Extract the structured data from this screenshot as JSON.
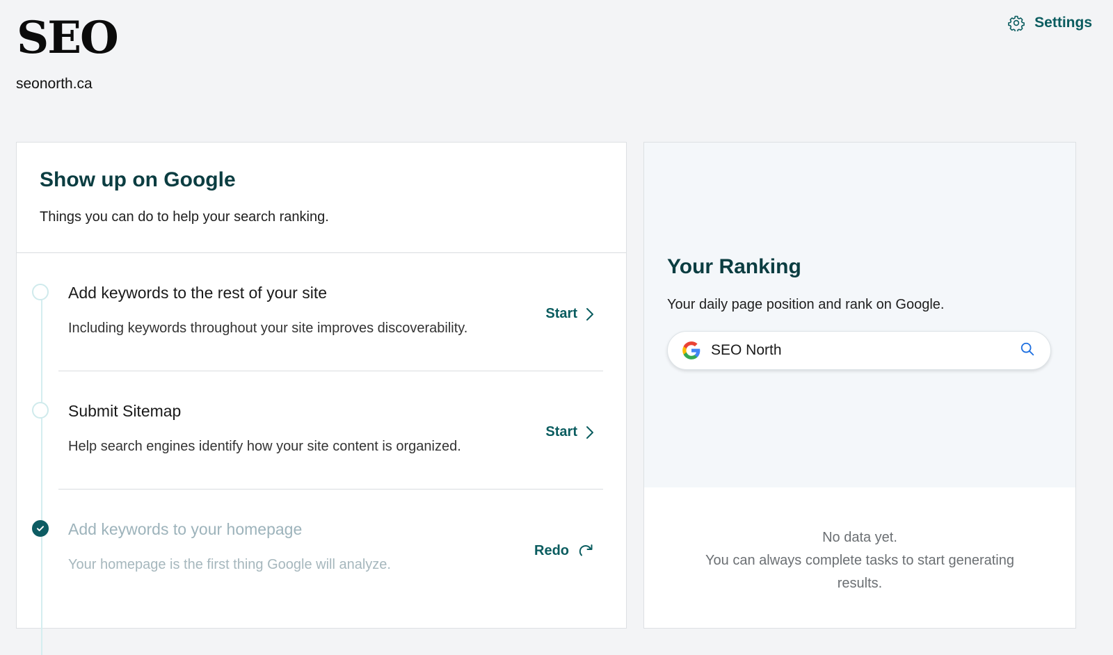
{
  "header": {
    "logo_text": "SEO",
    "domain": "seonorth.ca",
    "settings_label": "Settings",
    "settings_icon": "gear-icon"
  },
  "colors": {
    "accent": "#0a5c5f",
    "heading": "#0b3d41",
    "timeline": "#d4eef0",
    "page_background": "#f3f4f6"
  },
  "tasks_card": {
    "title": "Show up on Google",
    "subtitle": "Things you can do to help your search ranking.",
    "tasks": [
      {
        "title": "Add keywords to the rest of your site",
        "description": "Including keywords throughout your site improves discoverability.",
        "action_label": "Start",
        "action_icon": "chevron-right-icon",
        "status": "pending"
      },
      {
        "title": "Submit Sitemap",
        "description": "Help search engines identify how your site content is organized.",
        "action_label": "Start",
        "action_icon": "chevron-right-icon",
        "status": "pending"
      },
      {
        "title": "Add keywords to your homepage",
        "description": "Your homepage is the first thing Google will analyze.",
        "action_label": "Redo",
        "action_icon": "redo-icon",
        "status": "completed"
      }
    ]
  },
  "ranking_card": {
    "title": "Your Ranking",
    "subtitle": "Your daily page position and rank on Google.",
    "search": {
      "value": "SEO North",
      "provider_icon": "google-icon",
      "search_icon": "search-icon"
    },
    "empty_state": {
      "line1": "No data yet.",
      "line2": "You can always complete tasks to start generating results."
    }
  }
}
